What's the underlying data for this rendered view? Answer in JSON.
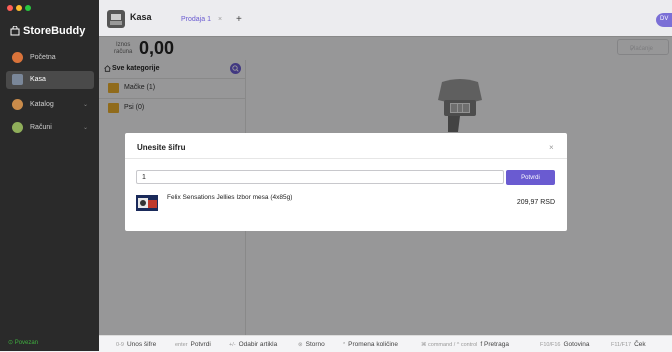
{
  "sidebar": {
    "logo": "StoreBuddy",
    "items": [
      {
        "label": "Početna",
        "icon": "home-icon",
        "has_chevron": false
      },
      {
        "label": "Kasa",
        "icon": "cash-register-icon",
        "has_chevron": false,
        "active": true
      },
      {
        "label": "Katalog",
        "icon": "catalog-icon",
        "has_chevron": true
      },
      {
        "label": "Računi",
        "icon": "receipts-icon",
        "has_chevron": true
      }
    ],
    "status": "Povezan"
  },
  "header": {
    "title": "Kasa",
    "tab_label": "Prodaja 1",
    "tab_close": "×",
    "add_tab": "+",
    "avatar_initials": "DV"
  },
  "amount": {
    "label_line1": "Iznos",
    "label_line2": "računa",
    "value": "0,00"
  },
  "payment_button": "Plaćanje",
  "categories": {
    "title": "Sve kategorije",
    "items": [
      {
        "label": "Mačke (1)"
      },
      {
        "label": "Psi (0)"
      }
    ]
  },
  "modal": {
    "title": "Unesite šifru",
    "close": "×",
    "input_value": "1",
    "confirm_label": "Potvrdi",
    "result": {
      "name": "Felix Sensations Jellies Izbor mesa (4x85g)",
      "price": "209,97 RSD"
    }
  },
  "shortcuts": [
    {
      "key": "0-9",
      "label": "Unos šifre"
    },
    {
      "key": "enter",
      "label": "Potvrdi"
    },
    {
      "key": "+/-",
      "label": "Odabir artikla"
    },
    {
      "key": "⊗",
      "label": "Storno"
    },
    {
      "key": "*",
      "label": "Promena količine"
    },
    {
      "key": "⌘ command / ^ control",
      "label": "f  Pretraga"
    },
    {
      "key": "F10/F16",
      "label": "Gotovina"
    },
    {
      "key": "F11/F17",
      "label": "Ček"
    }
  ],
  "colors": {
    "accent": "#6a5bd1",
    "sidebar_bg": "#2a2a2a",
    "folder": "#e8ad2e",
    "status_green": "#3fae3f"
  }
}
